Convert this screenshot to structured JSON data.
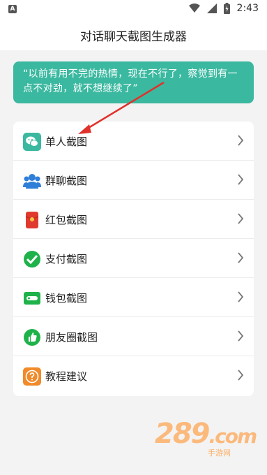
{
  "status_bar": {
    "time": "2:43"
  },
  "app_bar": {
    "title": "对话聊天截图生成器"
  },
  "tip": {
    "text": "“以前有用不完的热情，现在不行了，察觉到有一点不对劲，就不想继续了”"
  },
  "menu": {
    "items": [
      {
        "label": "单人截图",
        "icon": "wechat-chat-icon",
        "color": "#3bb8a0"
      },
      {
        "label": "群聊截图",
        "icon": "group-users-icon",
        "color": "#2f7fd8"
      },
      {
        "label": "红包截图",
        "icon": "red-packet-icon",
        "color": "#e03a2f"
      },
      {
        "label": "支付截图",
        "icon": "payment-check-icon",
        "color": "#1fb24a"
      },
      {
        "label": "钱包截图",
        "icon": "wallet-icon",
        "color": "#1fb24a"
      },
      {
        "label": "朋友圈截图",
        "icon": "moments-like-icon",
        "color": "#1fb24a"
      },
      {
        "label": "教程建议",
        "icon": "help-question-icon",
        "color": "#f08a2a"
      }
    ]
  },
  "watermark": {
    "brand": "289",
    "suffix": ".com",
    "sub": "手游网"
  },
  "colors": {
    "accent": "#3bb8a0",
    "annotation_arrow": "#e0312b"
  }
}
